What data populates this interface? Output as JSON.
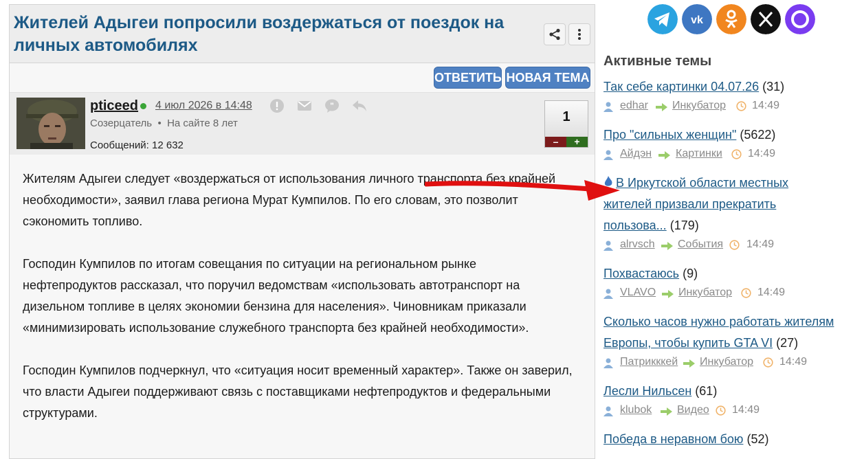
{
  "article": {
    "title": "Жителей Адыгеи попросили воздержаться от поездок на личных автомобилях",
    "reply_label": "ОТВЕТИТЬ",
    "new_topic_label": "НОВАЯ ТЕМА",
    "author": "pticeed",
    "date": "4 июл 2026 в 14:48",
    "role": "Созерцатель",
    "sep": "•",
    "on_site": "На сайте 8 лет",
    "posts_count": "Сообщений: 12 632",
    "rating": "1",
    "rating_minus": "–",
    "rating_plus": "+",
    "paragraphs": [
      "Жителям Адыгеи следует «воздержаться от использования личного транспорта без крайней необходимости», заявил глава региона Мурат Кумпилов. По его словам, это позволит сэкономить топливо.",
      "Господин Кумпилов по итогам совещания по ситуации на региональном рынке нефтепродуктов рассказал, что поручил ведомствам «использовать автотранспорт на дизельном топливе в целях экономии бензина для населения». Чиновникам приказали «минимизировать использование служебного транспорта без крайней необходимости».",
      "Господин Кумпилов подчеркнул, что «ситуация носит временный характер». Также он заверил, что власти Адыгеи поддерживают связь с поставщиками нефтепродуктов и федеральными структурами."
    ]
  },
  "sidebar": {
    "social": [
      {
        "name": "telegram-icon",
        "color": "#2aa3e0"
      },
      {
        "name": "vk-icon",
        "color": "#3e77c2"
      },
      {
        "name": "odnoklassniki-icon",
        "color": "#f1861f"
      },
      {
        "name": "x-icon",
        "color": "#111111"
      },
      {
        "name": "max-icon",
        "color": "#7a3cf0"
      }
    ],
    "title": "Активные темы",
    "topics": [
      {
        "title": "Так себе картинки 04.07.26",
        "count": "(31)",
        "user": "edhar",
        "category": "Инкубатор",
        "time": "14:49"
      },
      {
        "title": "Про \"сильных женщин\"",
        "count": "(5622)",
        "user": "Айдэн",
        "category": "Картинки",
        "time": "14:49"
      },
      {
        "title": "В Иркутской области местных жителей призвали прекратить пользова...",
        "count": "(179)",
        "user": "alrvsch",
        "category": "События",
        "time": "14:49"
      },
      {
        "title": "Похвастаюсь",
        "count": "(9)",
        "user": "VLAVO",
        "category": "Инкубатор",
        "time": "14:49"
      },
      {
        "title": "Сколько часов нужно работать жителям Европы, чтобы купить GTA VI",
        "count": "(27)",
        "user": "Патрикккей",
        "category": "Инкубатор",
        "time": "14:49"
      },
      {
        "title": "Лесли Нильсен",
        "count": "(61)",
        "user": "klubok",
        "category": "Видео",
        "time": "14:49"
      },
      {
        "title": "Победа в неравном бою",
        "count": "(52)",
        "user": "",
        "category": "",
        "time": ""
      }
    ]
  },
  "colors": {
    "accent": "#1d5a86",
    "button": "#4f81c2",
    "arrow": "#e01010"
  }
}
